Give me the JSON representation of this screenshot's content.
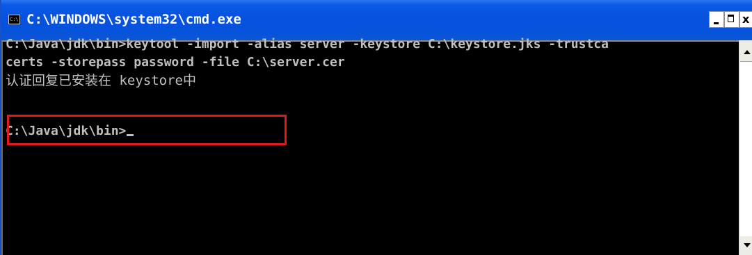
{
  "window": {
    "title": "C:\\WINDOWS\\system32\\cmd.exe",
    "icon": "console-icon",
    "icon_text": "C:\\",
    "buttons": {
      "minimize": "minimize-icon",
      "maximize": "maximize-icon",
      "close": "close-icon",
      "close_glyph": "x"
    }
  },
  "console": {
    "lines": [
      "C:\\Java\\jdk\\bin>keytool -import -alias server -keystore C:\\keystore.jks -trustca",
      "certs -storepass password -file C:\\server.cer",
      "认证回复已安装在 keystore中",
      "C:\\Java\\jdk\\bin>"
    ],
    "text_color": "#c0c0c0",
    "background": "#000000"
  },
  "annotation": {
    "highlight_color": "#e11919"
  },
  "colors": {
    "titlebar": "#0753e0",
    "scrollbar_track": "#eeede5"
  }
}
